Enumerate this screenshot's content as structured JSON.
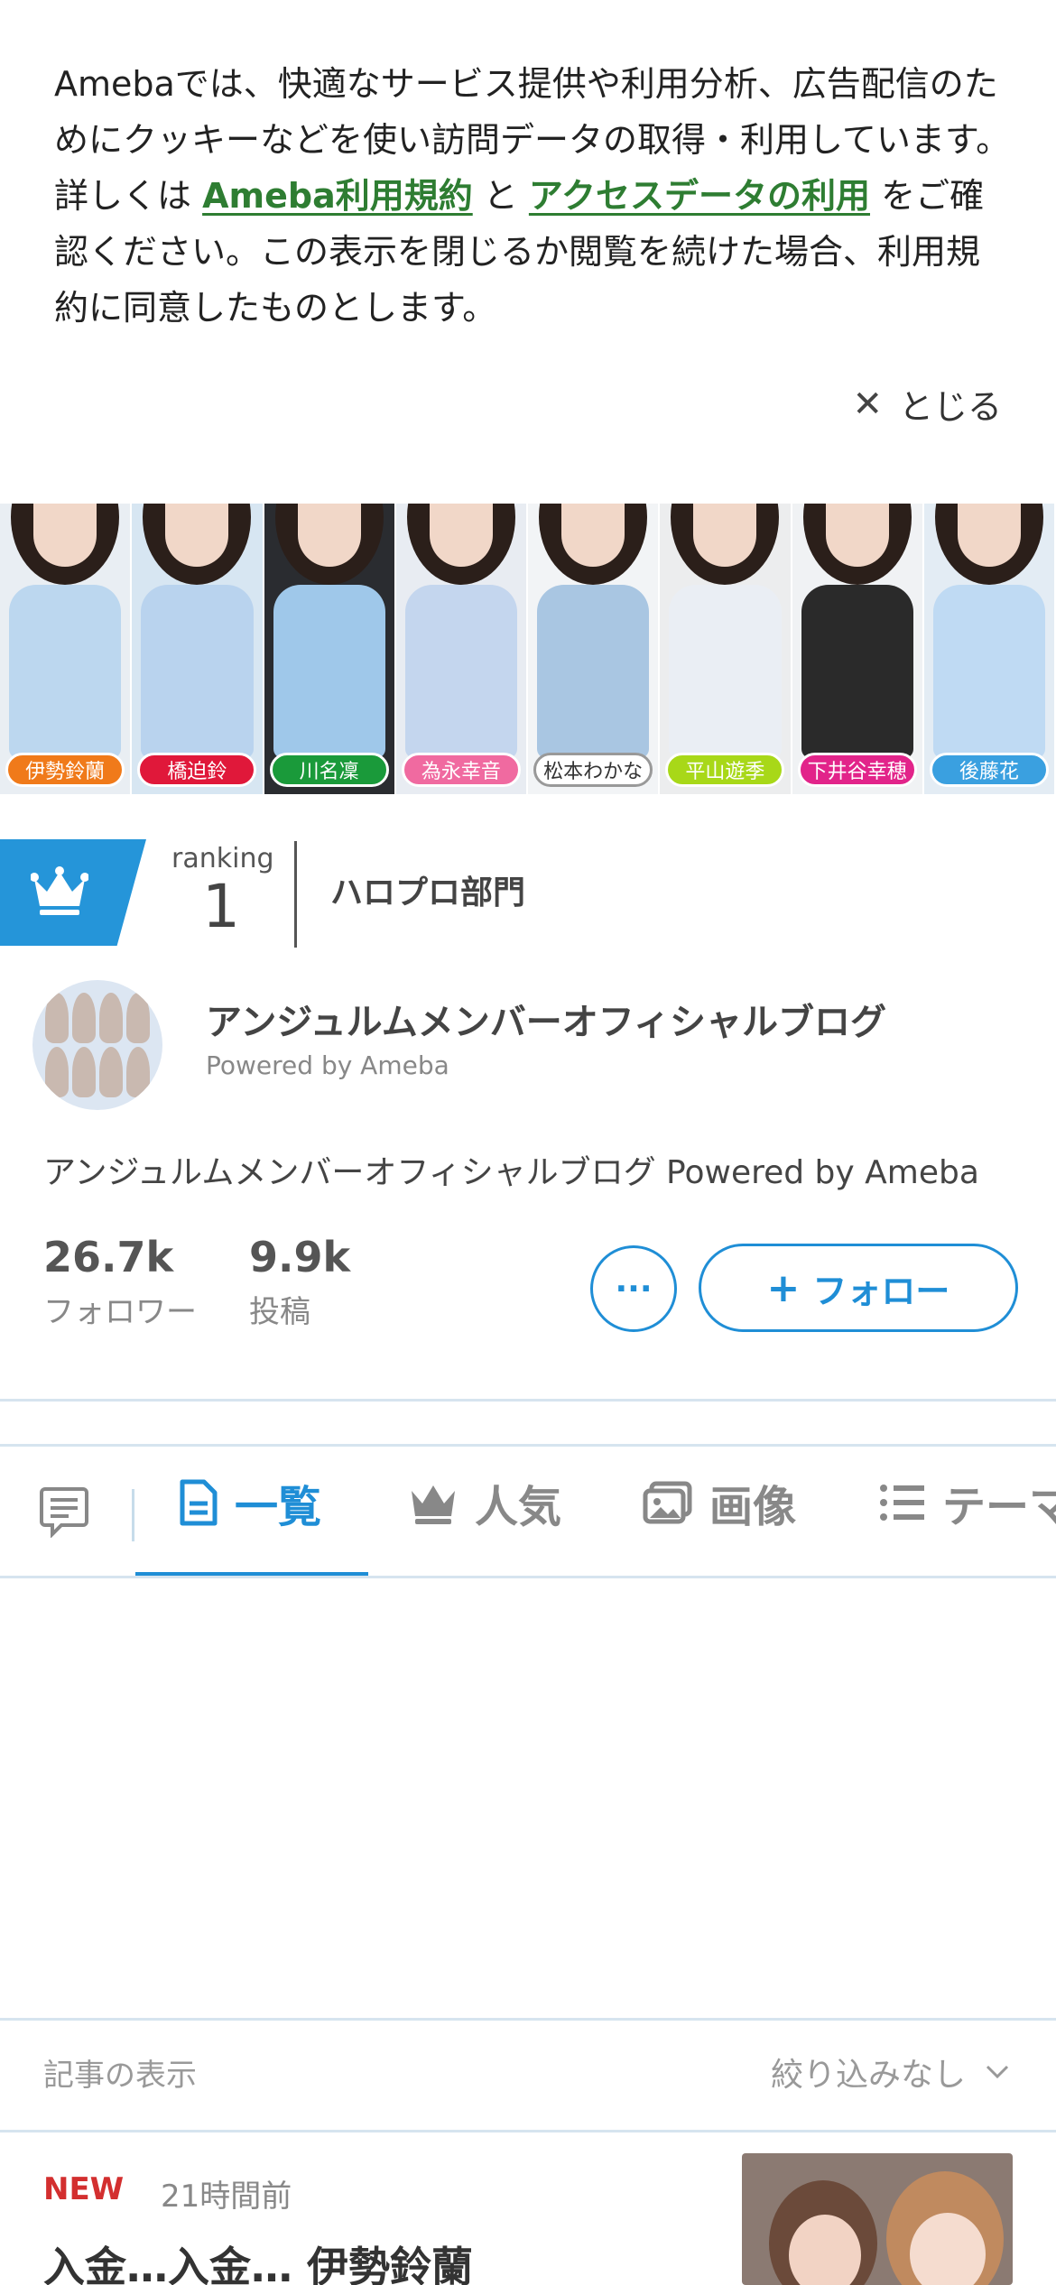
{
  "cookie_banner": {
    "text_part1": "Amebaでは、快適なサービス提供や利用分析、広告配信のためにクッキーなどを使い訪問データの取得・利用しています。詳しくは ",
    "link1": "Ameba利用規約",
    "text_part2": " と ",
    "link2": "アクセスデータの利用",
    "text_part3": " をご確認ください。この表示を閉じるか閲覧を続けた場合、利用規約に同意したものとします。",
    "close_label": "とじる"
  },
  "header_banner": {
    "members": [
      {
        "name": "伊勢鈴蘭",
        "color": "#f07a1a"
      },
      {
        "name": "橋迫鈴",
        "color": "#e0183a"
      },
      {
        "name": "川名凜",
        "color": "#1a9a3a"
      },
      {
        "name": "為永幸音",
        "color": "#f06aa0"
      },
      {
        "name": "松本わかな",
        "color": "#ffffff"
      },
      {
        "name": "平山遊季",
        "color": "#a8d818"
      },
      {
        "name": "下井谷幸穂",
        "color": "#e2248a"
      },
      {
        "name": "後藤花",
        "color": "#3aa0e0"
      }
    ]
  },
  "ranking": {
    "label": "ranking",
    "number": "1",
    "department": "ハロプロ部門"
  },
  "profile": {
    "title": "アンジュルムメンバーオフィシャルブログ",
    "powered": "Powered by Ameba",
    "description": "アンジュルムメンバーオフィシャルブログ Powered by Ameba",
    "followers_count": "26.7k",
    "followers_label": "フォロワー",
    "posts_count": "9.9k",
    "posts_label": "投稿",
    "more_label": "···",
    "follow_label": "フォロー"
  },
  "tabs": [
    {
      "label": "一覧",
      "icon": "document-icon",
      "active": true
    },
    {
      "label": "人気",
      "icon": "crown-icon",
      "active": false
    },
    {
      "label": "画像",
      "icon": "images-icon",
      "active": false
    },
    {
      "label": "テーマ",
      "icon": "list-icon",
      "active": false
    }
  ],
  "filter": {
    "label": "記事の表示",
    "value": "絞り込みなし"
  },
  "article": {
    "badge": "NEW",
    "time": "21時間前",
    "title": "入金…入金… 伊勢鈴蘭"
  },
  "colors": {
    "accent": "#1f8ed6",
    "link": "#2e7d32",
    "new_badge": "#d32f2f"
  }
}
